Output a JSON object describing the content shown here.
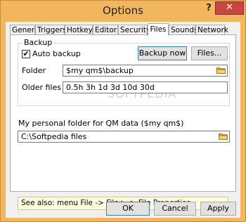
{
  "window": {
    "title": "Options",
    "help_label": "?",
    "close_label": "✕"
  },
  "tabs": [
    {
      "label": "General"
    },
    {
      "label": "Triggers"
    },
    {
      "label": "Hotkeys"
    },
    {
      "label": "Editor"
    },
    {
      "label": "Security"
    },
    {
      "label": "Files",
      "active": true
    },
    {
      "label": "Sounds"
    },
    {
      "label": "Network"
    }
  ],
  "backup": {
    "group_label": "Backup",
    "auto_backup_label": "Auto backup",
    "auto_backup_checked": true,
    "backup_now_label": "Backup now",
    "files_label": "Files...",
    "folder_label": "Folder",
    "folder_value": "$my qm$\\backup",
    "older_files_label": "Older files",
    "older_files_value": "0.5h 3h 1d 3d 10d 30d"
  },
  "personal": {
    "label": "My personal folder for QM data ($my qm$)",
    "value": "C:\\Softpedia files"
  },
  "see_also": "See also: menu File -> File+ -> File Properties",
  "footer": {
    "ok_label": "OK",
    "cancel_label": "Cancel",
    "apply_label": "Apply"
  },
  "watermark": "SOFTPEDIA",
  "colors": {
    "frame": "#f2b660",
    "close": "#c7463e",
    "hint_bg": "#ffffe1",
    "folder": "#e8b84a"
  }
}
